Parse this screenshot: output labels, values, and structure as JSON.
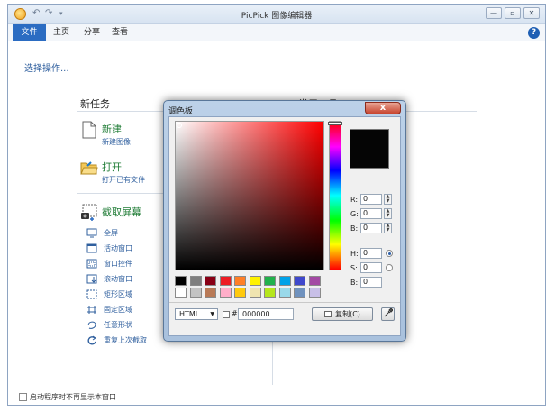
{
  "window": {
    "title": "PicPick 图像编辑器",
    "minimize": "—",
    "maximize": "▫",
    "close": "✕"
  },
  "quick_access": {
    "undo": "↶",
    "redo": "↷",
    "more": "▾"
  },
  "ribbon": {
    "tabs": [
      {
        "label": "文件"
      },
      {
        "label": "主页"
      },
      {
        "label": "分享"
      },
      {
        "label": "查看"
      }
    ],
    "help": "?"
  },
  "page": {
    "select_prompt": "选择操作...",
    "new_task_heading": "新任务",
    "tools_heading_partial": "常用工具",
    "new": {
      "title": "新建",
      "sub": "新建图像"
    },
    "open": {
      "title": "打开",
      "sub": "打开已有文件"
    },
    "capture": {
      "title": "截取屏幕",
      "items": [
        {
          "label": "全屏",
          "icon": "monitor-icon"
        },
        {
          "label": "活动窗口",
          "icon": "window-icon"
        },
        {
          "label": "窗口控件",
          "icon": "control-icon"
        },
        {
          "label": "滚动窗口",
          "icon": "scroll-window-icon"
        },
        {
          "label": "矩形区域",
          "icon": "rectangle-icon"
        },
        {
          "label": "固定区域",
          "icon": "fixed-region-icon"
        },
        {
          "label": "任意形状",
          "icon": "freeform-icon"
        },
        {
          "label": "重复上次截取",
          "icon": "repeat-icon"
        }
      ]
    },
    "footer_checkbox": "启动程序时不再显示本窗口"
  },
  "dialog": {
    "title": "调色板",
    "close": "x",
    "rgb": {
      "r_label": "R:",
      "r": "0",
      "g_label": "G:",
      "g": "0",
      "b_label": "B:",
      "b": "0"
    },
    "hsb": {
      "h_label": "H:",
      "h": "0",
      "s_label": "S:",
      "s": "0",
      "b_label": "B:",
      "b": "0"
    },
    "preview_color": "#050505",
    "swatches_row1": [
      "#000000",
      "#7f7f7f",
      "#880015",
      "#ed1c24",
      "#ff7f27",
      "#fff200",
      "#22b14c",
      "#00a2e8",
      "#3f48cc",
      "#a349a4"
    ],
    "swatches_row2": [
      "#ffffff",
      "#c3c3c3",
      "#b97a57",
      "#ffaec9",
      "#ffc90e",
      "#efe4b0",
      "#b5e61d",
      "#99d9ea",
      "#7092be",
      "#c8bfe7"
    ],
    "format": "HTML",
    "hash": "#",
    "hex": "000000",
    "copy_label": "复制(C)"
  }
}
